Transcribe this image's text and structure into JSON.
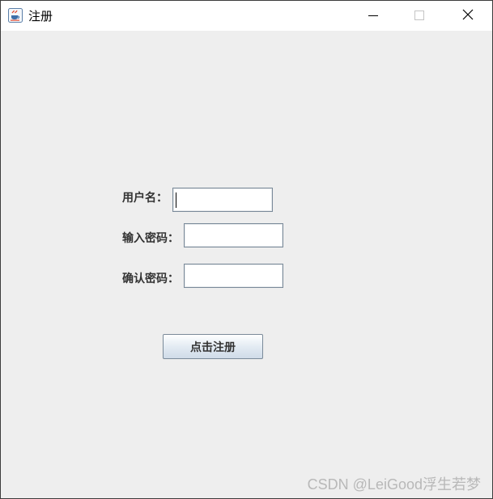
{
  "window": {
    "title": "注册",
    "icon": "java-coffee-cup-icon",
    "controls": {
      "minimize_icon": "minimize-icon",
      "maximize_icon": "maximize-icon",
      "close_icon": "close-icon"
    }
  },
  "form": {
    "username_label": "用户名：",
    "username_value": "",
    "password_label": "输入密码：",
    "password_value": "",
    "confirm_label": "确认密码：",
    "confirm_value": "",
    "submit_label": "点击注册"
  },
  "watermark": "CSDN @LeiGood浮生若梦",
  "colors": {
    "background": "#eeeeee",
    "titlebar": "#ffffff",
    "label_text": "#333333",
    "field_border": "#7a8a99",
    "button_gradient_top": "#ffffff",
    "button_gradient_bottom": "#cfdbe8"
  }
}
